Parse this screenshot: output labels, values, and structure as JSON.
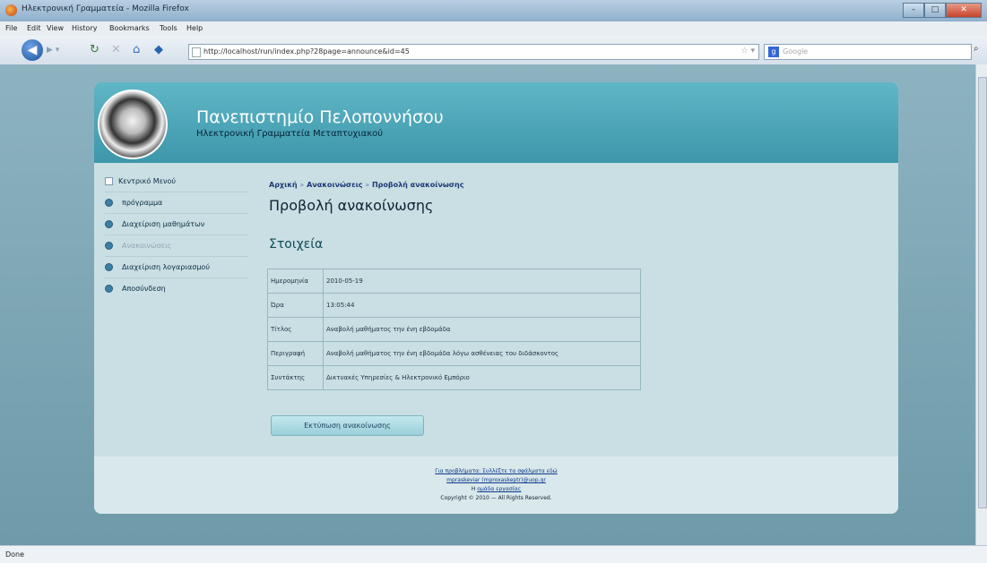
{
  "window": {
    "title": "Ηλεκτρονική Γραμματεία - Mozilla Firefox",
    "min": "–",
    "max": "□",
    "close": "✕"
  },
  "menu": [
    "File",
    "Edit",
    "View",
    "History",
    "Bookmarks",
    "Tools",
    "Help"
  ],
  "nav": {
    "url": "http://localhost/run/index.php?28page=announce&id=45",
    "search_placeholder": "Google"
  },
  "header": {
    "title": "Πανεπιστημίο Πελοποννήσου",
    "subtitle": "Ηλεκτρονική Γραμματεία Μεταπτυχιακού"
  },
  "sidebar": {
    "items": [
      {
        "label": "Κεντρικό Μενού"
      },
      {
        "label": "πρόγραμμα"
      },
      {
        "label": "Διαχείριση μαθημάτων"
      },
      {
        "label": "Ανακοινώσεις"
      },
      {
        "label": "Διαχείριση λογαριασμού"
      },
      {
        "label": "Αποσύνδεση"
      }
    ]
  },
  "breadcrumb": {
    "home": "Αρχική",
    "sep1": "»",
    "section": "Ανακοινώσεις",
    "sep2": "»",
    "current": "Προβολή ανακοίνωσης"
  },
  "main": {
    "title": "Προβολή ανακοίνωσης",
    "section": "Στοιχεία",
    "rows": [
      {
        "label": "Ημερομηνία",
        "value": "2010-05-19"
      },
      {
        "label": "Ώρα",
        "value": "13:05:44"
      },
      {
        "label": "Τίτλος",
        "value": "Αναβολή μαθήματος την ένη εβδομάδα"
      },
      {
        "label": "Περιγραφή",
        "value": "Αναβολή μαθήματος την ένη εβδομάδα λόγω ασθένειας του διδάσκοντος"
      },
      {
        "label": "Συντάκτης",
        "value": "Δικτυακές Υπηρεσίες & Ηλεκτρονικό Εμπόριο"
      }
    ],
    "print_button": "Εκτύπωση ανακοίνωσης"
  },
  "footer": {
    "line1": "Για προβλήματα: Συλλέξτε τα σφάλματα εδώ",
    "line2": "mpraskeviar (mproxaskeptr)@uop.gr",
    "line3_prefix": "Η ",
    "line3_link": "ομάδα εργασίας",
    "copyright": "Copyright © 2010 — All Rights Reserved."
  },
  "status": {
    "text": "Done"
  }
}
